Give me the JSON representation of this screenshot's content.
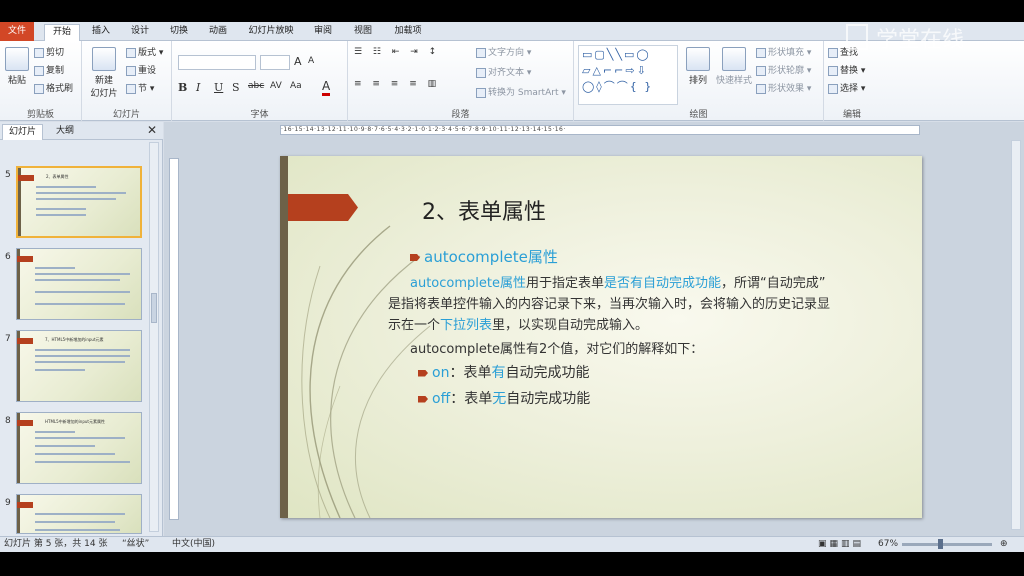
{
  "tabs": [
    "文件",
    "开始",
    "插入",
    "设计",
    "切换",
    "动画",
    "幻灯片放映",
    "审阅",
    "视图",
    "加载项"
  ],
  "ribbon": {
    "clipboard": {
      "paste": "粘贴",
      "cut": "剪切",
      "copy": "复制",
      "format_painter": "格式刷",
      "label": "剪贴板"
    },
    "slides": {
      "new_slide": "新建",
      "new_slide_2": "幻灯片",
      "layout": "版式",
      "reset": "重设",
      "section": "节",
      "label": "幻灯片"
    },
    "font": {
      "label": "字体",
      "bold": "B",
      "italic": "I",
      "underline": "U",
      "shadow": "S",
      "strike": "abc",
      "spacing": "AV",
      "case": "Aa",
      "color": "A",
      "grow": "A",
      "shrink": "A"
    },
    "paragraph": {
      "label": "段落",
      "text_direction": "文字方向",
      "align_text": "对齐文本",
      "smartart": "转换为 SmartArt"
    },
    "drawing": {
      "label": "绘图",
      "arrange": "排列",
      "quick_styles": "快速样式",
      "shape_fill": "形状填充",
      "shape_outline": "形状轮廓",
      "shape_effects": "形状效果",
      "shapes_glyphs": "▭▢╲╲▭◯ ▱△⌐⌐⇨⇩ ◯◊⌒⌒{ }"
    },
    "editing": {
      "label": "编辑",
      "find": "查找",
      "replace": "替换",
      "select": "选择"
    }
  },
  "left_panel": {
    "tabs": [
      "幻灯片",
      "大纲"
    ],
    "close": "✕",
    "thumbnails": [
      {
        "num": "5",
        "title": "2、表单属性"
      },
      {
        "num": "6",
        "title": ""
      },
      {
        "num": "7",
        "title": "7、HTML5中新增加的input元素"
      },
      {
        "num": "8",
        "title": "HTML5中新增加的input元素属性"
      },
      {
        "num": "9",
        "title": ""
      }
    ]
  },
  "ruler_text": "·16·15·14·13·12·11·10·9·8·7·6·5·4·3·2·1·0·1·2·3·4·5·6·7·8·9·10·11·12·13·14·15·16·",
  "slide": {
    "title": "2、表单属性",
    "heading": "autocomplete属性",
    "para1_a": "autocomplete属性",
    "para1_b": "用于指定表单",
    "para1_c": "是否有自动完成功能",
    "para1_d": "，所谓“自动完成”",
    "para2": "是指将表单控件输入的内容记录下来，当再次输入时，会将输入的历史记录显",
    "para3_a": "示在一个",
    "para3_b": "下拉列表",
    "para3_c": "里，以实现自动完成输入。",
    "para4": "autocomplete属性有2个值，对它们的解释如下：",
    "item1_key": "on",
    "item1_a": "：表单",
    "item1_b": "有",
    "item1_c": "自动完成功能",
    "item2_key": "off",
    "item2_a": "：表单",
    "item2_b": "无",
    "item2_c": "自动完成功能"
  },
  "status": {
    "slide_info": "幻灯片 第 5 张，共 14 张",
    "theme": "“丝状”",
    "language": "中文(中国)",
    "zoom": "67%"
  },
  "watermark": "学堂在线"
}
